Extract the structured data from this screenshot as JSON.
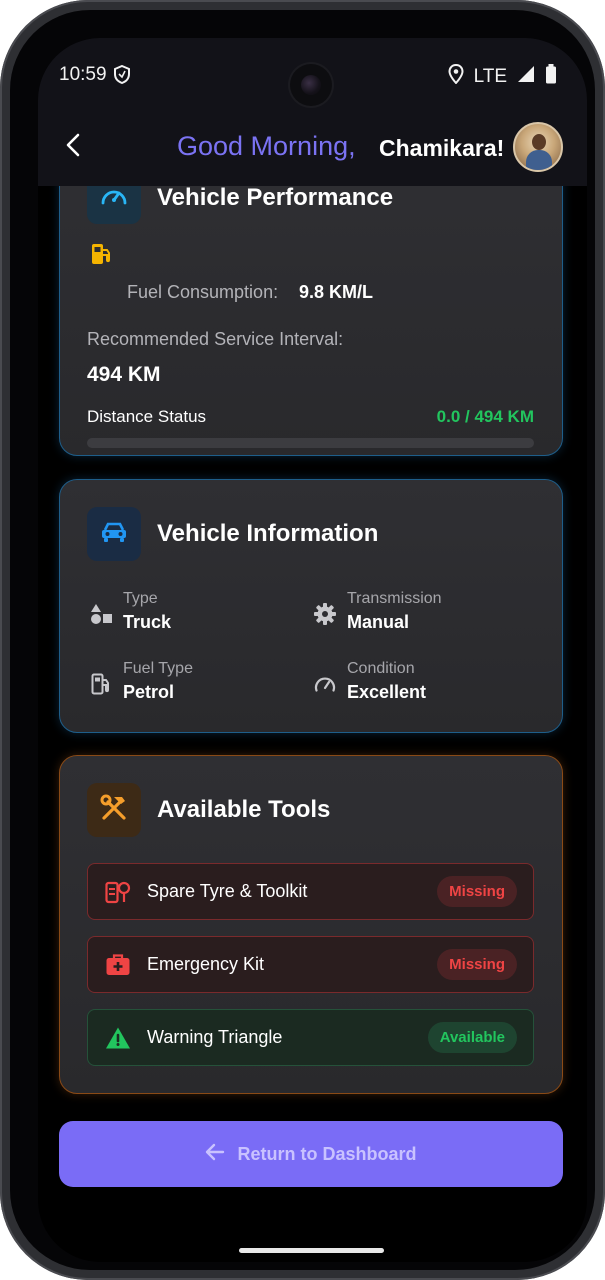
{
  "status_bar": {
    "time": "10:59",
    "network": "LTE"
  },
  "header": {
    "greeting": "Good Morning,",
    "user_name": "Chamikara!"
  },
  "performance": {
    "title": "Vehicle Performance",
    "fuel_label": "Fuel Consumption:",
    "fuel_value": "9.8 KM/L",
    "service_label": "Recommended Service Interval:",
    "service_value": "494 KM",
    "distance_label": "Distance Status",
    "distance_value": "0.0 / 494 KM",
    "distance_progress": 0.0
  },
  "info": {
    "title": "Vehicle Information",
    "type_label": "Type",
    "type_value": "Truck",
    "transmission_label": "Transmission",
    "transmission_value": "Manual",
    "fuel_type_label": "Fuel Type",
    "fuel_type_value": "Petrol",
    "condition_label": "Condition",
    "condition_value": "Excellent"
  },
  "tools": {
    "title": "Available Tools",
    "items": [
      {
        "name": "Spare Tyre & Toolkit",
        "status": "Missing",
        "icon": "toolkit-icon"
      },
      {
        "name": "Emergency Kit",
        "status": "Missing",
        "icon": "first-aid-kit-icon"
      },
      {
        "name": "Warning Triangle",
        "status": "Available",
        "icon": "warning-triangle-icon"
      }
    ]
  },
  "footer": {
    "return_label": "Return to Dashboard"
  },
  "colors": {
    "accent": "#7a6cf6",
    "success": "#22c55e",
    "danger": "#ef4444",
    "info_blue": "#2196f3",
    "tools_orange": "#f59e2b"
  }
}
